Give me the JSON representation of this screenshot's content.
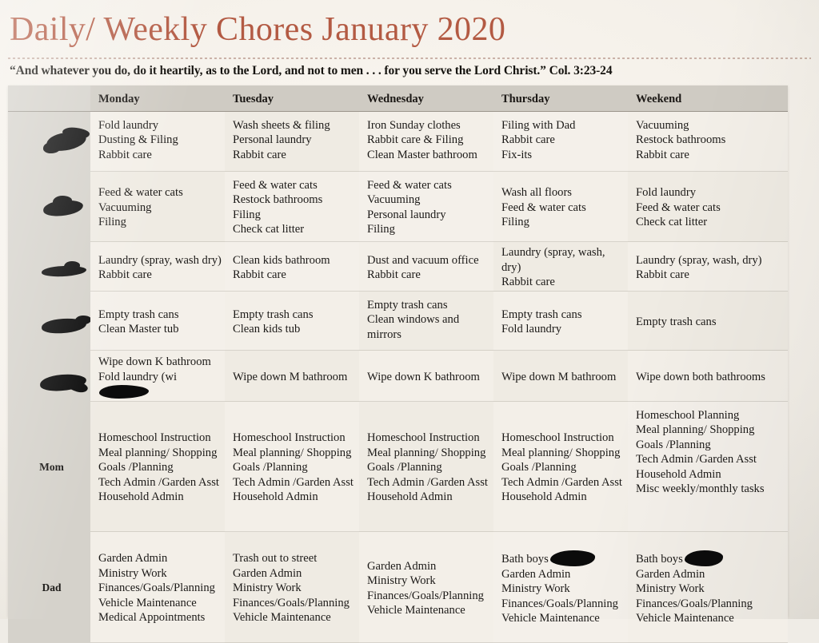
{
  "header": {
    "title": "Daily/ Weekly Chores January 2020",
    "verse": "“And whatever you do, do it heartily, as to the Lord, and not to men . . . for you serve the Lord Christ.” Col. 3:23-24",
    "title_color": "#b35a43"
  },
  "table": {
    "columns": [
      "",
      "Monday",
      "Tuesday",
      "Wednesday",
      "Thursday",
      "Weekend"
    ],
    "rows": [
      {
        "person": "",
        "person_redacted": true,
        "monday": [
          "Fold laundry",
          "Dusting & Filing",
          "Rabbit care"
        ],
        "tuesday": [
          "Wash sheets & filing",
          "Personal laundry",
          "Rabbit care"
        ],
        "wednesday": [
          "Iron Sunday clothes",
          "Rabbit care & Filing",
          "Clean Master bathroom"
        ],
        "thursday": [
          "Filing with Dad",
          "Rabbit care",
          "Fix-its"
        ],
        "weekend": [
          "Vacuuming",
          "Restock bathrooms",
          "Rabbit care"
        ]
      },
      {
        "person": "",
        "person_redacted": true,
        "monday": [
          "Feed & water cats",
          "Vacuuming",
          "Filing"
        ],
        "tuesday": [
          "Feed & water cats",
          "Restock bathrooms",
          "Filing",
          "Check cat litter"
        ],
        "wednesday": [
          "Feed & water cats",
          "Vacuuming",
          "Personal laundry",
          "Filing"
        ],
        "thursday": [
          "Wash all floors",
          "Feed & water cats",
          "Filing"
        ],
        "weekend": [
          "Fold laundry",
          "Feed & water cats",
          "Check cat litter"
        ]
      },
      {
        "person": "",
        "person_redacted": true,
        "monday": [
          "Laundry (spray, wash dry)",
          "Rabbit care"
        ],
        "tuesday": [
          "Clean kids bathroom",
          "Rabbit care"
        ],
        "wednesday": [
          "Dust and vacuum office",
          "Rabbit care"
        ],
        "thursday": [
          "Laundry (spray, wash, dry)",
          "Rabbit care"
        ],
        "weekend": [
          "Laundry (spray, wash, dry)",
          "Rabbit care"
        ]
      },
      {
        "person": "",
        "person_redacted": true,
        "monday": [
          "Empty trash cans",
          "Clean Master tub"
        ],
        "tuesday": [
          "Empty trash cans",
          "Clean kids tub"
        ],
        "wednesday": [
          "Empty trash cans",
          "Clean windows and mirrors"
        ],
        "thursday": [
          "Empty trash cans",
          "Fold laundry"
        ],
        "weekend": [
          "Empty trash cans"
        ]
      },
      {
        "person": "",
        "person_redacted": true,
        "monday": [
          "Wipe down K bathroom",
          "Fold laundry (wi"
        ],
        "monday_redacted": true,
        "tuesday": [
          "Wipe down M bathroom"
        ],
        "wednesday": [
          "Wipe down K bathroom"
        ],
        "thursday": [
          "Wipe down M bathroom"
        ],
        "weekend": [
          "Wipe down both bathrooms"
        ]
      },
      {
        "person": "Mom",
        "person_redacted": false,
        "monday": [
          "Homeschool Instruction",
          "Meal planning/ Shopping",
          "Goals /Planning",
          "Tech Admin /Garden Asst",
          "Household Admin"
        ],
        "tuesday": [
          "Homeschool Instruction",
          "Meal planning/ Shopping",
          "Goals /Planning",
          "Tech Admin /Garden Asst",
          "Household Admin"
        ],
        "wednesday": [
          "Homeschool Instruction",
          "Meal planning/ Shopping",
          "Goals /Planning",
          "Tech Admin /Garden Asst",
          "Household Admin"
        ],
        "thursday": [
          "Homeschool Instruction",
          "Meal planning/ Shopping",
          "Goals /Planning",
          "Tech Admin /Garden Asst",
          "Household Admin"
        ],
        "weekend": [
          "Homeschool Planning",
          "Meal planning/ Shopping",
          "Goals /Planning",
          "Tech Admin /Garden Asst",
          "Household Admin",
          "Misc weekly/monthly tasks"
        ]
      },
      {
        "person": "Dad",
        "person_redacted": false,
        "monday": [
          "Garden Admin",
          "Ministry Work",
          "Finances/Goals/Planning",
          "Vehicle Maintenance",
          "Medical Appointments"
        ],
        "tuesday": [
          "Trash out to street",
          "Garden Admin",
          "Ministry Work",
          "Finances/Goals/Planning",
          "Vehicle Maintenance"
        ],
        "wednesday": [
          "Garden Admin",
          "Ministry Work",
          "Finances/Goals/Planning",
          "Vehicle Maintenance"
        ],
        "thursday": [
          "Bath boys",
          "Garden Admin",
          "Ministry Work",
          "Finances/Goals/Planning",
          "Vehicle Maintenance"
        ],
        "thursday_redacted": true,
        "weekend": [
          "Bath boys",
          "Garden Admin",
          "Ministry Work",
          "Finances/Goals/Planning",
          "Vehicle Maintenance"
        ],
        "weekend_redacted": true
      }
    ]
  }
}
